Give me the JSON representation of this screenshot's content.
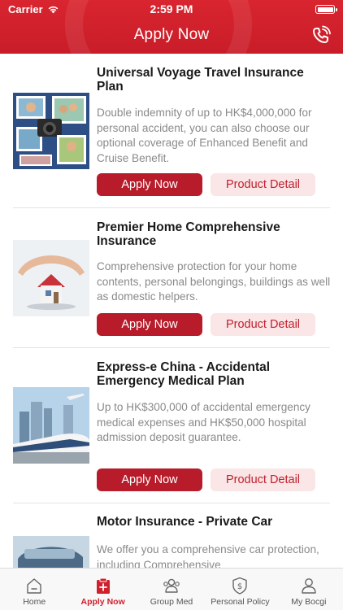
{
  "status": {
    "carrier": "Carrier",
    "time": "2:59 PM"
  },
  "header": {
    "title": "Apply Now"
  },
  "products": [
    {
      "title": "Universal Voyage Travel Insurance Plan",
      "description": "Double indemnity of up to HK$4,000,000 for personal accident, you can also choose our optional coverage of Enhanced Benefit and Cruise Benefit.",
      "apply_label": "Apply Now",
      "detail_label": "Product Detail"
    },
    {
      "title": "Premier Home Comprehensive Insurance",
      "description": "Comprehensive protection for your home contents, personal belongings, buildings as well as domestic helpers.",
      "apply_label": "Apply Now",
      "detail_label": "Product Detail"
    },
    {
      "title": "Express-e China - Accidental Emergency Medical Plan",
      "description": "Up to HK$300,000 of accidental emergency medical expenses and HK$50,000 hospital admission deposit guarantee.",
      "apply_label": "Apply Now",
      "detail_label": "Product Detail"
    },
    {
      "title": "Motor Insurance - Private Car",
      "description": "We offer you a comprehensive car protection, including Comprehensive"
    }
  ],
  "tabs": [
    {
      "label": "Home",
      "icon": "home-icon"
    },
    {
      "label": "Apply Now",
      "icon": "apply-icon"
    },
    {
      "label": "Group Med",
      "icon": "group-icon"
    },
    {
      "label": "Personal Policy",
      "icon": "policy-icon"
    },
    {
      "label": "My Bocgi",
      "icon": "profile-icon"
    }
  ],
  "colors": {
    "brand": "#c81d29",
    "apply_button": "#b81c2a",
    "detail_button_bg": "#fbe6e7"
  }
}
